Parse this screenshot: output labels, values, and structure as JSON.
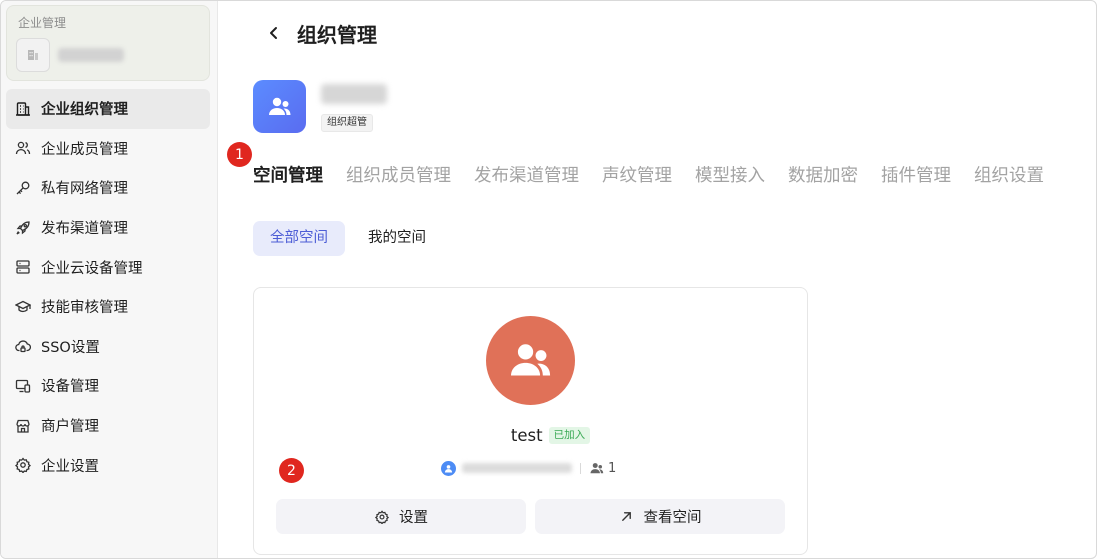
{
  "sidebar": {
    "org_card_title": "企业管理",
    "items": [
      {
        "label": "企业组织管理",
        "icon": "building-icon"
      },
      {
        "label": "企业成员管理",
        "icon": "users-icon"
      },
      {
        "label": "私有网络管理",
        "icon": "key-icon"
      },
      {
        "label": "发布渠道管理",
        "icon": "rocket-icon"
      },
      {
        "label": "企业云设备管理",
        "icon": "server-icon"
      },
      {
        "label": "技能审核管理",
        "icon": "graduation-cap-icon"
      },
      {
        "label": "SSO设置",
        "icon": "cloud-lock-icon"
      },
      {
        "label": "设备管理",
        "icon": "devices-icon"
      },
      {
        "label": "商户管理",
        "icon": "store-icon"
      },
      {
        "label": "企业设置",
        "icon": "gear-icon"
      }
    ],
    "active_index": 0
  },
  "header": {
    "title": "组织管理"
  },
  "org": {
    "role_tag": "组织超管"
  },
  "badges": {
    "step1": "1",
    "step2": "2"
  },
  "tabs": [
    {
      "label": "空间管理"
    },
    {
      "label": "组织成员管理"
    },
    {
      "label": "发布渠道管理"
    },
    {
      "label": "声纹管理"
    },
    {
      "label": "模型接入"
    },
    {
      "label": "数据加密"
    },
    {
      "label": "插件管理"
    },
    {
      "label": "组织设置"
    }
  ],
  "subtabs": [
    {
      "label": "全部空间"
    },
    {
      "label": "我的空间"
    }
  ],
  "space_card": {
    "name": "test",
    "joined_label": "已加入",
    "member_count": "1",
    "settings_label": "设置",
    "view_label": "查看空间"
  },
  "colors": {
    "accent": "#4d5dd6",
    "org_avatar": "#5a7af5",
    "space_avatar": "#e07158",
    "step_badge": "#e0271f",
    "joined_green": "#3aaa55"
  }
}
